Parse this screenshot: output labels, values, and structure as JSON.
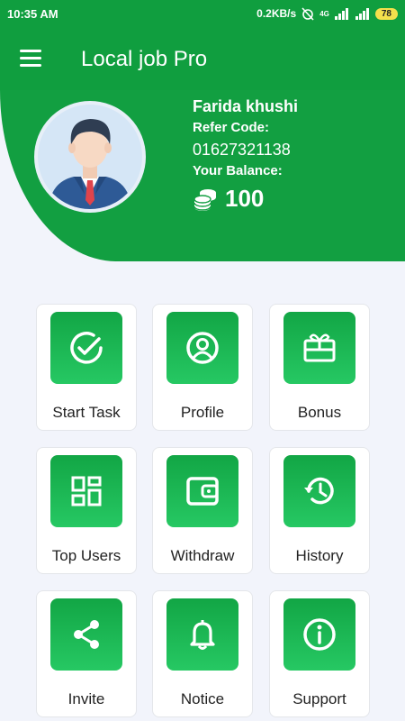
{
  "status_bar": {
    "time": "10:35 AM",
    "network_speed": "0.2KB/s",
    "signal_label": "4G",
    "battery": "78"
  },
  "header": {
    "title": "Local job Pro"
  },
  "profile": {
    "name": "Farida khushi",
    "refer_label": "Refer Code:",
    "refer_code": "01627321138",
    "balance_label": "Your Balance:",
    "balance": "100"
  },
  "menu": [
    {
      "label": "Start Task",
      "icon": "check-circle-icon"
    },
    {
      "label": "Profile",
      "icon": "user-circle-icon"
    },
    {
      "label": "Bonus",
      "icon": "gift-icon"
    },
    {
      "label": "Top Users",
      "icon": "dashboard-icon"
    },
    {
      "label": "Withdraw",
      "icon": "wallet-icon"
    },
    {
      "label": "History",
      "icon": "history-icon"
    },
    {
      "label": "Invite",
      "icon": "share-icon"
    },
    {
      "label": "Notice",
      "icon": "bell-icon"
    },
    {
      "label": "Support",
      "icon": "info-icon"
    }
  ],
  "colors": {
    "primary": "#109e3f",
    "tile_gradient_top": "#12a645",
    "tile_gradient_bottom": "#26c863",
    "background": "#f2f4fb"
  }
}
